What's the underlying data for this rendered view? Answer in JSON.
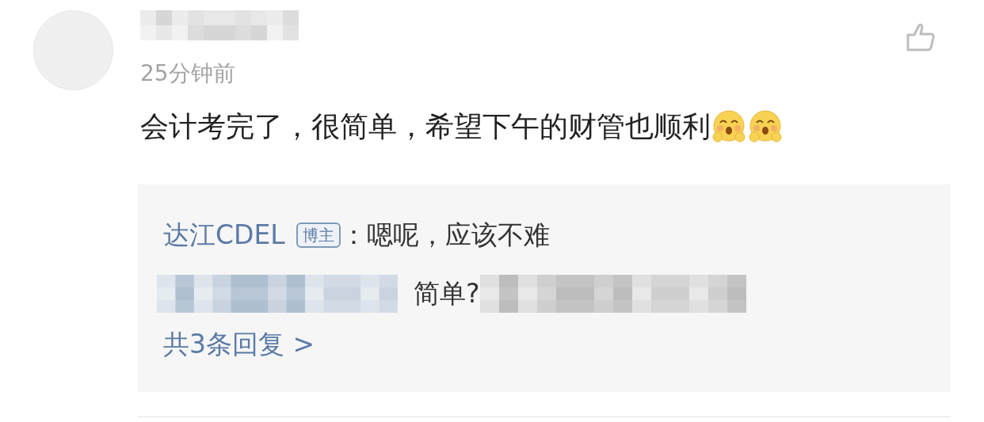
{
  "comment": {
    "time": "25分钟前",
    "text": "会计考完了，很简单，希望下午的财管也顺利",
    "emoji": [
      {
        "kind": "hug"
      },
      {
        "kind": "hug"
      }
    ],
    "replies": {
      "author": "达江CDEL",
      "badge": "博主",
      "text": "：嗯呢，应该不难",
      "second_text": "简单?",
      "more": "共3条回复 >"
    }
  }
}
